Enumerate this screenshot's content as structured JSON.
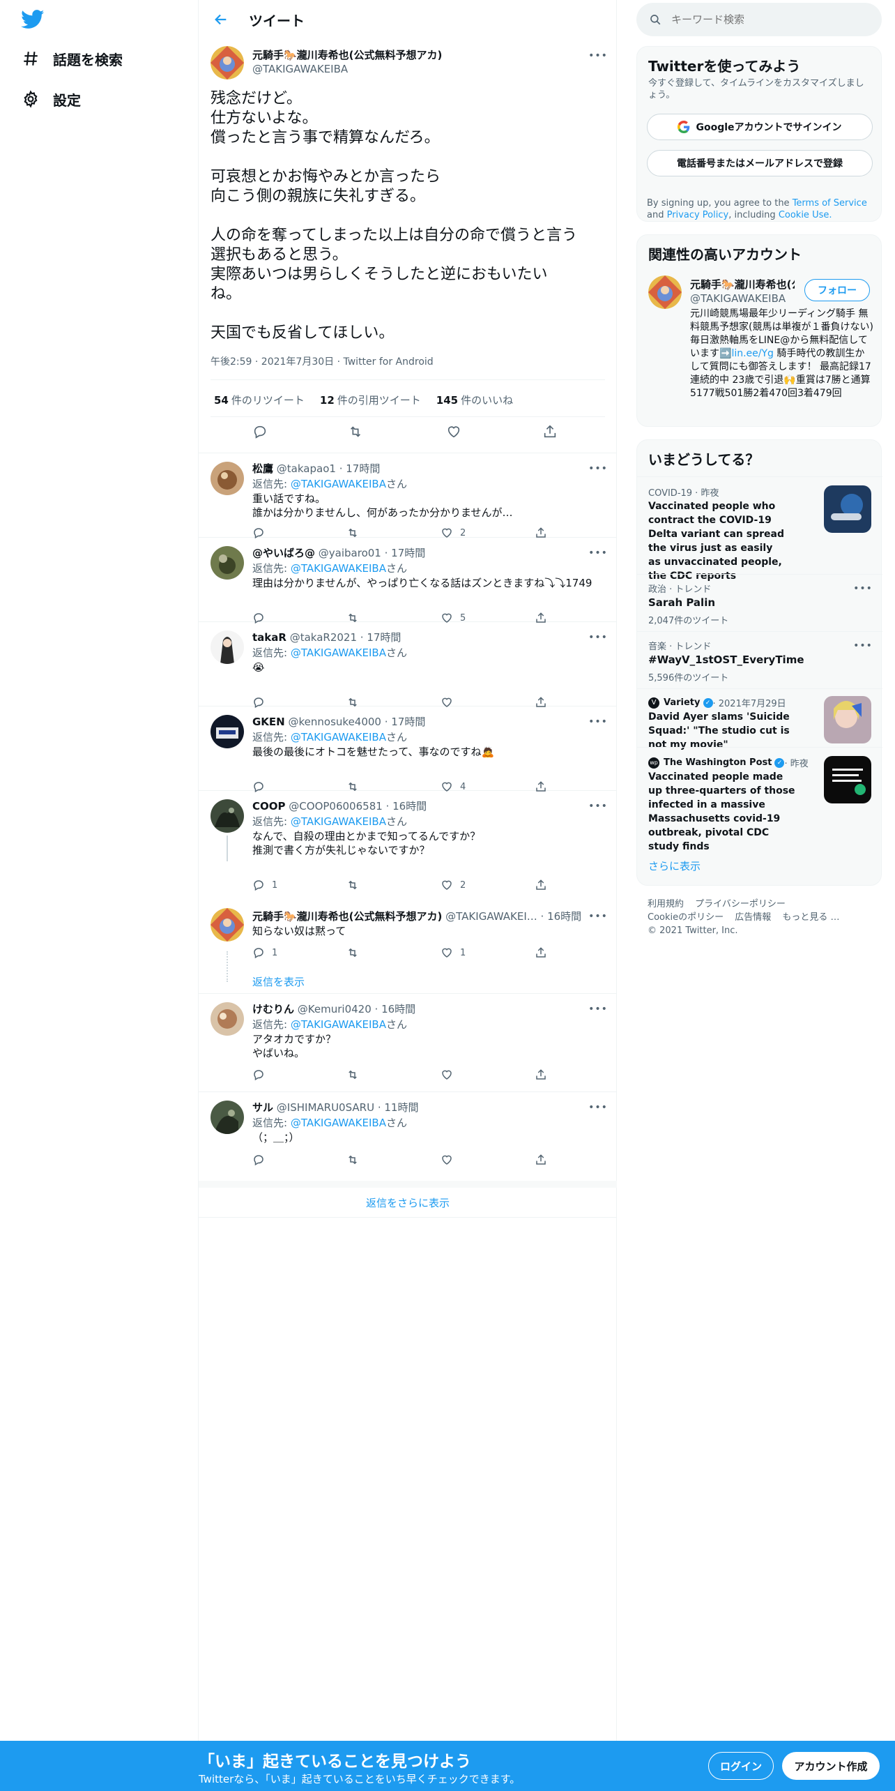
{
  "nav": {
    "items": [
      {
        "label": "話題を検索",
        "icon": "hashtag-icon"
      },
      {
        "label": "設定",
        "icon": "gear-icon"
      }
    ]
  },
  "header": {
    "title": "ツイート"
  },
  "main_tweet": {
    "name": "元騎手🐎瀧川寿希也(公式無料予想アカ)",
    "handle": "@TAKIGAWAKEIBA",
    "text": "残念だけど。\n仕方ないよな。\n償ったと言う事で精算なんだろ。\n\n可哀想とかお悔やみとか言ったら\n向こう側の親族に失礼すぎる。\n\n人の命を奪ってしまった以上は自分の命で償うと言う\n選択もあると思う。\n実際あいつは男らしくそうしたと逆におもいたい\nね。\n\n天国でも反省してほしい。",
    "meta": "午後2:59 · 2021年7月30日 · Twitter for Android",
    "retweets": "54",
    "retweets_label": "件のリツイート",
    "quotes": "12",
    "quotes_label": "件の引用ツイート",
    "likes": "145",
    "likes_label": "件のいいね"
  },
  "replies": [
    {
      "name": "松鷹",
      "handle": "@takapao1",
      "time": "17時間",
      "reply_to_prefix": "返信先: ",
      "reply_to": "@TAKIGAWAKEIBA",
      "reply_to_suffix": "さん",
      "text": "重い話ですね。\n誰かは分かりませんし、何があったか分かりませんが…",
      "replies": "",
      "retweets": "",
      "likes": "2"
    },
    {
      "name": "@やいばろ@",
      "handle": "@yaibaro01",
      "time": "17時間",
      "reply_to_prefix": "返信先: ",
      "reply_to": "@TAKIGAWAKEIBA",
      "reply_to_suffix": "さん",
      "text": "理由は分かりませんが、やっぱり亡くなる話はズンときますね⤵⤵1749",
      "replies": "",
      "retweets": "",
      "likes": "5"
    },
    {
      "name": "takaR",
      "handle": "@takaR2021",
      "time": "17時間",
      "reply_to_prefix": "返信先: ",
      "reply_to": "@TAKIGAWAKEIBA",
      "reply_to_suffix": "さん",
      "text": "😭",
      "replies": "",
      "retweets": "",
      "likes": ""
    },
    {
      "name": "GKEN",
      "handle": "@kennosuke4000",
      "time": "17時間",
      "reply_to_prefix": "返信先: ",
      "reply_to": "@TAKIGAWAKEIBA",
      "reply_to_suffix": "さん",
      "text": "最後の最後にオトコを魅せたって、事なのですね🙇",
      "replies": "",
      "retweets": "",
      "likes": "4"
    },
    {
      "name": "COOP",
      "handle": "@COOP06006581",
      "time": "16時間",
      "reply_to_prefix": "返信先: ",
      "reply_to": "@TAKIGAWAKEIBA",
      "reply_to_suffix": "さん",
      "text": "なんで、自殺の理由とかまで知ってるんですか？\n推測で書く方が失礼じゃないですか？",
      "replies": "1",
      "retweets": "",
      "likes": "2"
    },
    {
      "name": "元騎手🐎瀧川寿希也(公式無料予想アカ)",
      "handle": "@TAKIGAWAKEI…",
      "time": "16時間",
      "reply_to_prefix": "",
      "reply_to": "",
      "reply_to_suffix": "",
      "text": "知らない奴は黙って",
      "replies": "1",
      "retweets": "",
      "likes": "1",
      "show_replies": "返信を表示"
    },
    {
      "name": "けむりん",
      "handle": "@Kemuri0420",
      "time": "16時間",
      "reply_to_prefix": "返信先: ",
      "reply_to": "@TAKIGAWAKEIBA",
      "reply_to_suffix": "さん",
      "text": "アタオカですか？\nやばいね。",
      "replies": "",
      "retweets": "",
      "likes": ""
    },
    {
      "name": "サル",
      "handle": "@ISHIMARU0SARU",
      "time": "11時間",
      "reply_to_prefix": "返信先: ",
      "reply_to": "@TAKIGAWAKEIBA",
      "reply_to_suffix": "さん",
      "text": "（；＿；）",
      "replies": "",
      "retweets": "",
      "likes": ""
    }
  ],
  "more_replies": "返信をさらに表示",
  "search": {
    "placeholder": "キーワード検索"
  },
  "signup_card": {
    "title": "Twitterを使ってみよう",
    "desc": "今すぐ登録して、タイムラインをカスタマイズしましょう。",
    "google_btn": "Googleアカウントでサインイン",
    "phone_btn": "電話番号またはメールアドレスで登録",
    "terms_pre": "By signing up, you agree to the ",
    "terms_link1": "Terms of Service",
    "terms_mid": " and ",
    "terms_link2": "Privacy Policy",
    "terms_mid2": ", including ",
    "terms_link3": "Cookie Use.",
    "terms_post": ""
  },
  "related": {
    "title": "関連性の高いアカウント",
    "name": "元騎手🐎瀧川寿希也(公",
    "handle": "@TAKIGAWAKEIBA",
    "follow": "フォロー",
    "bio_pre": "元川崎競馬場最年少リーディング騎手 無料競馬予想家(競馬は単複が１番負けない) 毎日激熱軸馬をLINE@から無料配信しています➡️",
    "bio_link": "lin.ee/Yg",
    "bio_post": " 騎手時代の教訓生かして質問にも御答えします！ 最高記録17連続的中 23歳で引退🙌重賞は7勝と通算5177戦501勝2着470回3着479回"
  },
  "trends": {
    "title": "いまどうしてる？",
    "items": [
      {
        "category": "COVID-19 · 昨夜",
        "title": "Vaccinated people who contract the COVID-19 Delta variant can spread the virus just as easily as unvaccinated people, the CDC reports",
        "sub": ""
      },
      {
        "category": "政治 · トレンド",
        "title": "Sarah Palin",
        "sub": "2,047件のツイート"
      },
      {
        "category": "音楽 · トレンド",
        "title": "#WayV_1stOST_EveryTime",
        "sub": "5,596件のツイート"
      },
      {
        "category_name": "Variety",
        "category_time": " · 2021年7月29日",
        "title": "David Ayer slams 'Suicide Squad:' \"The studio cut is not my movie\"",
        "sub": ""
      },
      {
        "category_name": "The Washington Post",
        "category_time": " · 昨夜",
        "title": "Vaccinated people made up three-quarters of those infected in a massive Massachusetts covid-19 outbreak, pivotal CDC study finds",
        "sub": ""
      }
    ],
    "show_more": "さらに表示"
  },
  "footer": {
    "links": [
      "利用規約",
      "プライバシーポリシー",
      "Cookieのポリシー",
      "広告情報",
      "もっと見る …"
    ],
    "copyright": "© 2021 Twitter, Inc."
  },
  "banner": {
    "title": "「いま」起きていることを見つけよう",
    "sub": "Twitterなら、「いま」起きていることをいち早くチェックできます。",
    "login": "ログイン",
    "signup": "アカウント作成"
  },
  "colors": {
    "accent": "#1d9bf0",
    "text": "#0f1419",
    "muted": "#536471"
  }
}
